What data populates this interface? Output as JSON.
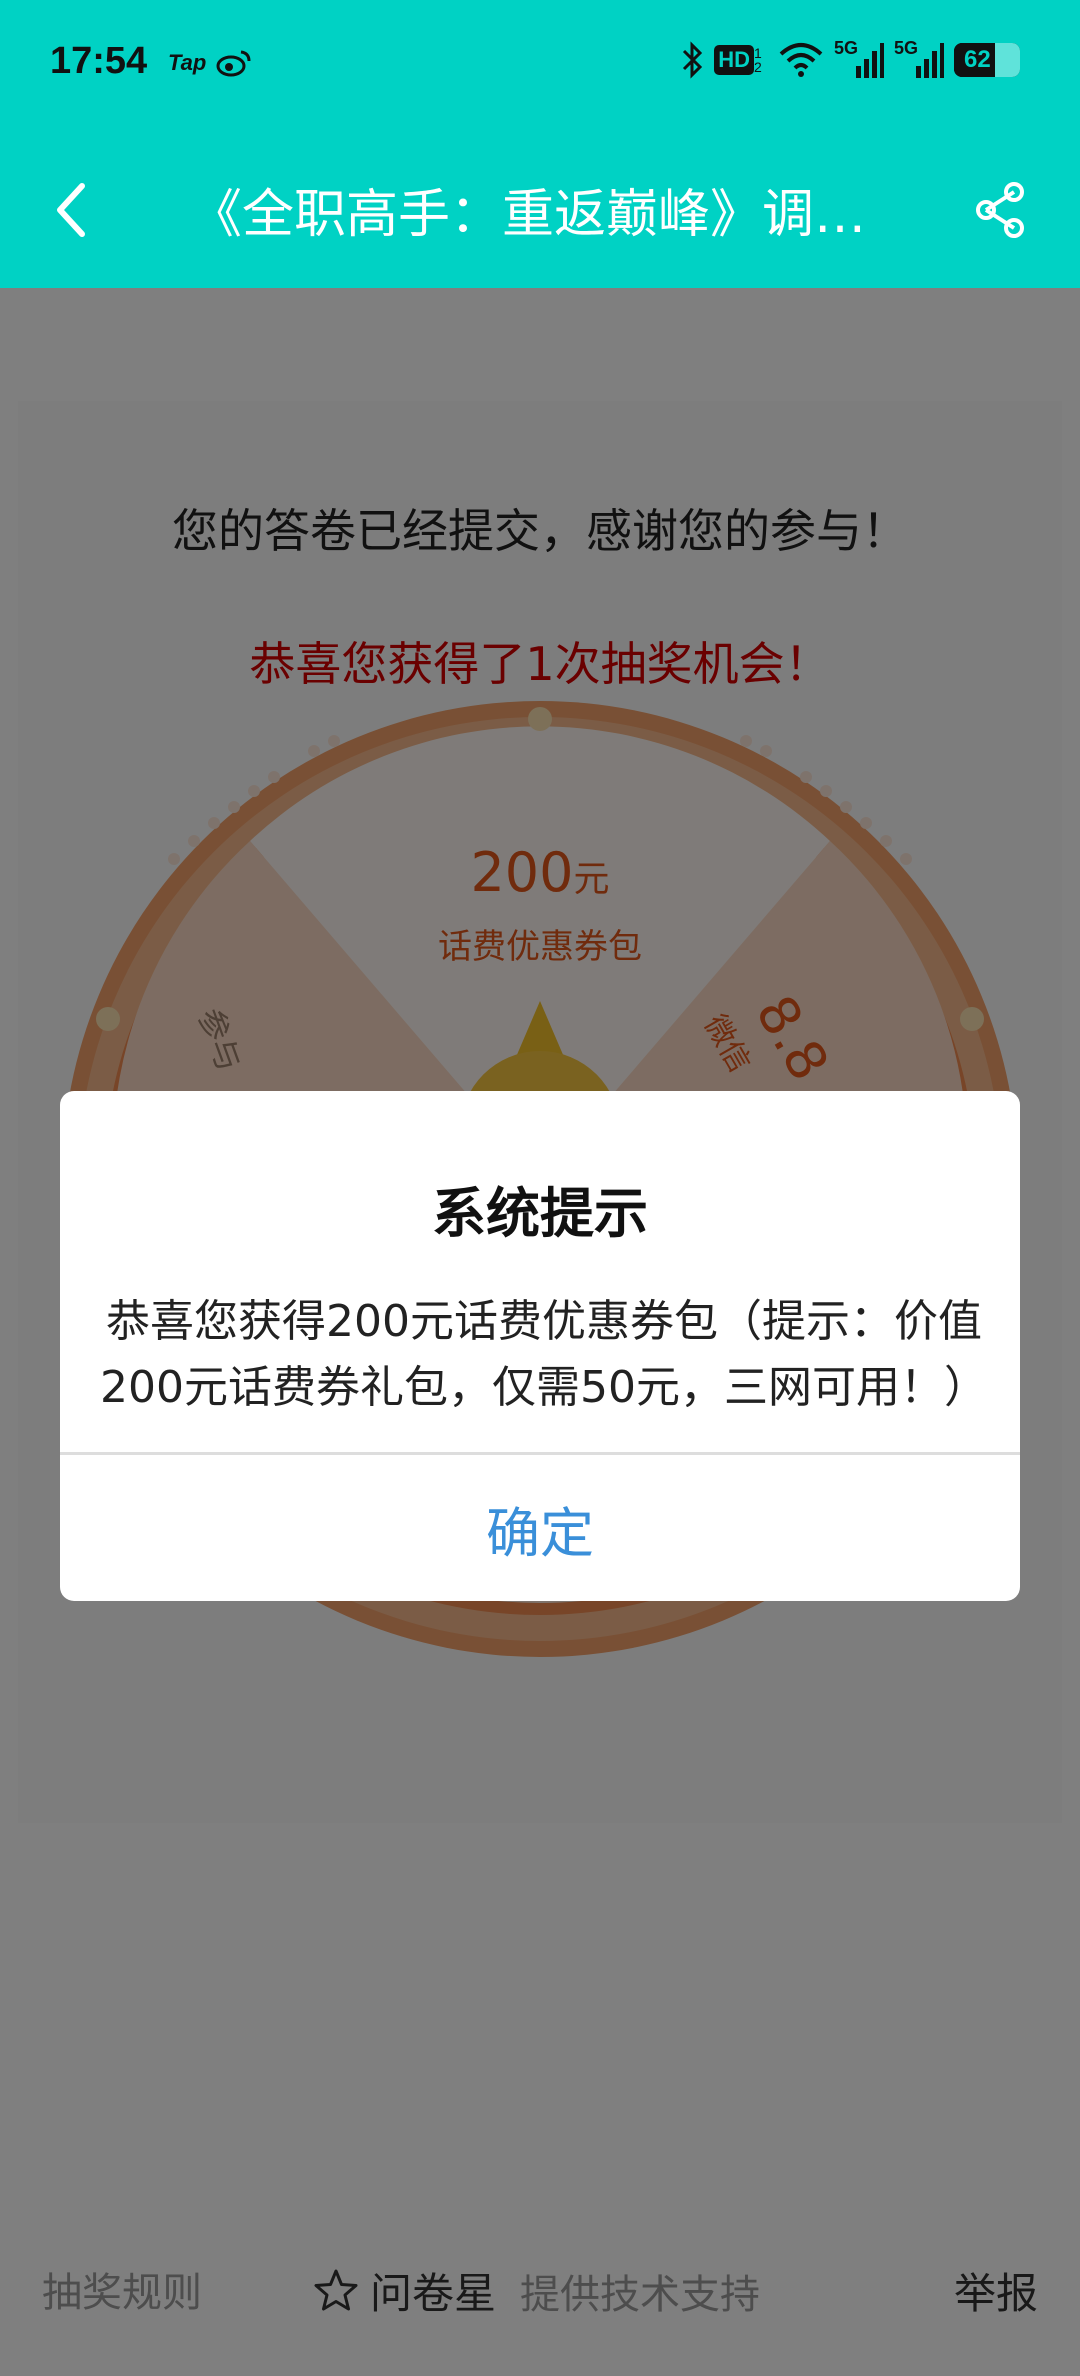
{
  "status_bar": {
    "time": "17:54",
    "app_label": "Tap",
    "battery": "62",
    "network": "5G",
    "hd_label": "HD",
    "hd_sub": "1 2",
    "icons": [
      "weibo-icon",
      "bluetooth-icon",
      "hd-icon",
      "wifi-icon",
      "signal-5g-icon",
      "signal-5g-icon",
      "battery-icon"
    ]
  },
  "header": {
    "title": "《全职高手：重返巅峰》调查问卷",
    "back_icon": "chevron-left-icon",
    "share_icon": "share-icon",
    "background": "#00d2c4"
  },
  "page": {
    "thanks_text": "您的答卷已经提交，感谢您的参与！",
    "congrats_text": "恭喜您获得了1次抽奖机会！"
  },
  "wheel": {
    "prize_top_value": "200",
    "prize_top_unit": "元",
    "prize_top_desc": "话费优惠券包",
    "prize_right_value": "8.8",
    "prize_right_desc": "微信",
    "prize_left_text": "参与"
  },
  "footer": {
    "rules": "抽奖规则",
    "brand": "问卷星",
    "support": "提供技术支持",
    "report": "举报"
  },
  "dialog": {
    "title": "系统提示",
    "message": "恭喜您获得200元话费优惠券包（提示：价值200元话费券礼包，仅需50元，三网可用！）",
    "confirm": "确定",
    "confirm_color": "#3a8fd9"
  }
}
